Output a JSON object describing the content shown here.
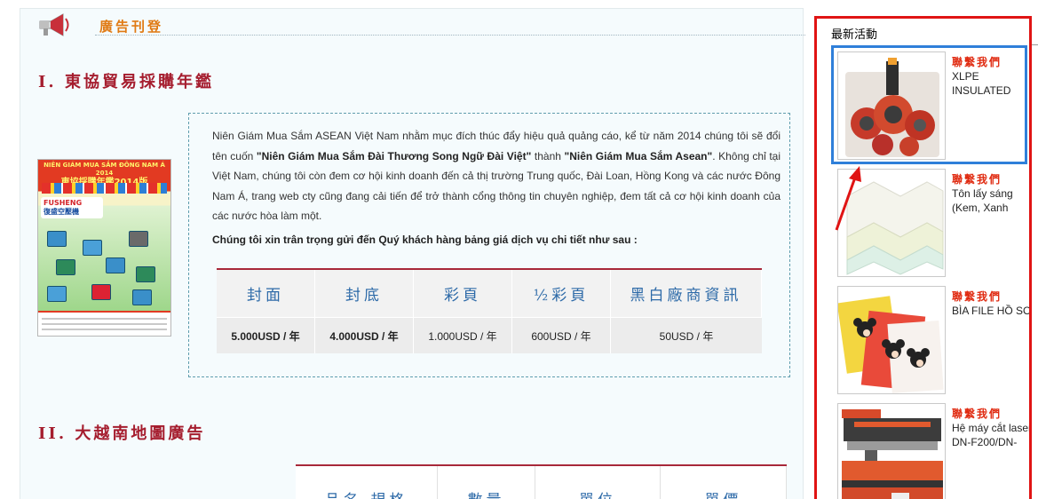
{
  "section": {
    "title": "廣告刊登"
  },
  "heading1": "I. 東協貿易採購年鑑",
  "heading2": "II. 大越南地圖廣告",
  "cover": {
    "top_line1": "NIÊN GIÁM MUA SẮM ĐÔNG NAM Á 2014",
    "top_line2": "東協採購年鑑2014版",
    "brand_en": "FUSHENG",
    "brand_zh": "復盛空壓機"
  },
  "intro": {
    "p1_a": "Niên Giám Mua Sắm ASEAN Việt Nam nhằm mục đích thúc đẩy hiệu quả quảng cáo, kể từ năm 2014 chúng tôi sẽ đổi tên cuốn ",
    "p1_b": "\"Niên Giám Mua Sắm Đài Thương Song Ngữ Đài Việt\"",
    "p1_c": " thành ",
    "p1_d": "\"Niên Giám Mua Sắm Asean\"",
    "p1_e": ". Không chỉ tại Việt Nam, chúng tôi còn đem cơ hội kinh doanh đến cả thị trường Trung quốc, Đài Loan, Hồng Kong và các nước Đông Nam Á, trang web cty cũng đang cải tiến để trở thành cổng thông tin chuyên nghiệp, đem tất cả cơ hội kinh doanh của các nước hòa làm một.",
    "subtitle": "Chúng tôi xin trân trọng gửi đến Quý khách hàng bảng giá dịch vụ chi tiết như sau :"
  },
  "price_table": {
    "headers": [
      "封面",
      "封底",
      "彩頁",
      "½彩頁",
      "黑白廠商資訊"
    ],
    "values": [
      "5.000USD / 年",
      "4.000USD / 年",
      "1.000USD / 年",
      "600USD / 年",
      "50USD / 年"
    ]
  },
  "table2": {
    "headers": [
      "品名-規格",
      "數量",
      "單位",
      "單價"
    ]
  },
  "sidebar": {
    "title": "最新活動",
    "items": [
      {
        "contact": "聯繫我們",
        "line1": "XLPE",
        "line2": "INSULATED"
      },
      {
        "contact": "聯繫我們",
        "line1": "Tôn lấy sáng",
        "line2": "(Kem, Xanh"
      },
      {
        "contact": "聯繫我們",
        "line1": "BÌA FILE HỒ SƠ",
        "line2": ""
      },
      {
        "contact": "聯繫我們",
        "line1": "Hệ máy cắt laser",
        "line2": "DN-F200/DN-"
      }
    ]
  },
  "colors": {
    "accent_red": "#e01414",
    "accent_blue": "#2f7fd9",
    "heading": "#a51d2e",
    "table_head": "#2d6aa8"
  }
}
